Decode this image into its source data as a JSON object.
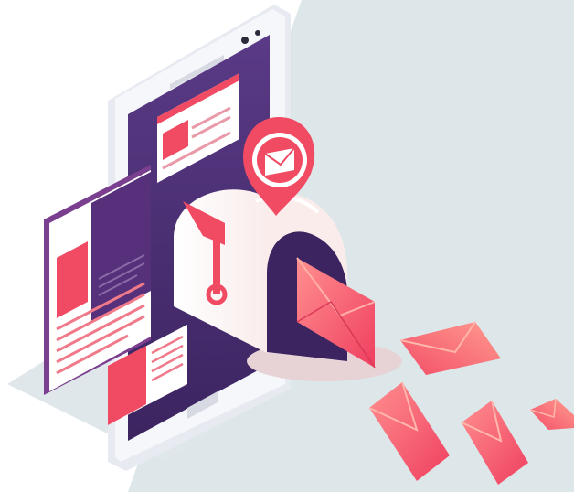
{
  "illustration": {
    "subject": "",
    "colors": {
      "background_panel": "#dde6e8",
      "phone_body": "#f1f2f7",
      "phone_screen": "#4a2f73",
      "card_white": "#ffffff",
      "accent_red": "#f04b63",
      "accent_pink": "#ff8a8a",
      "lines": "#e99aa8",
      "mailbox": "#fbecec",
      "mailbox_shadow": "#e7d3d6"
    },
    "icons": [
      "smartphone",
      "mailbox",
      "envelope",
      "location-pin-envelope",
      "flag"
    ]
  }
}
